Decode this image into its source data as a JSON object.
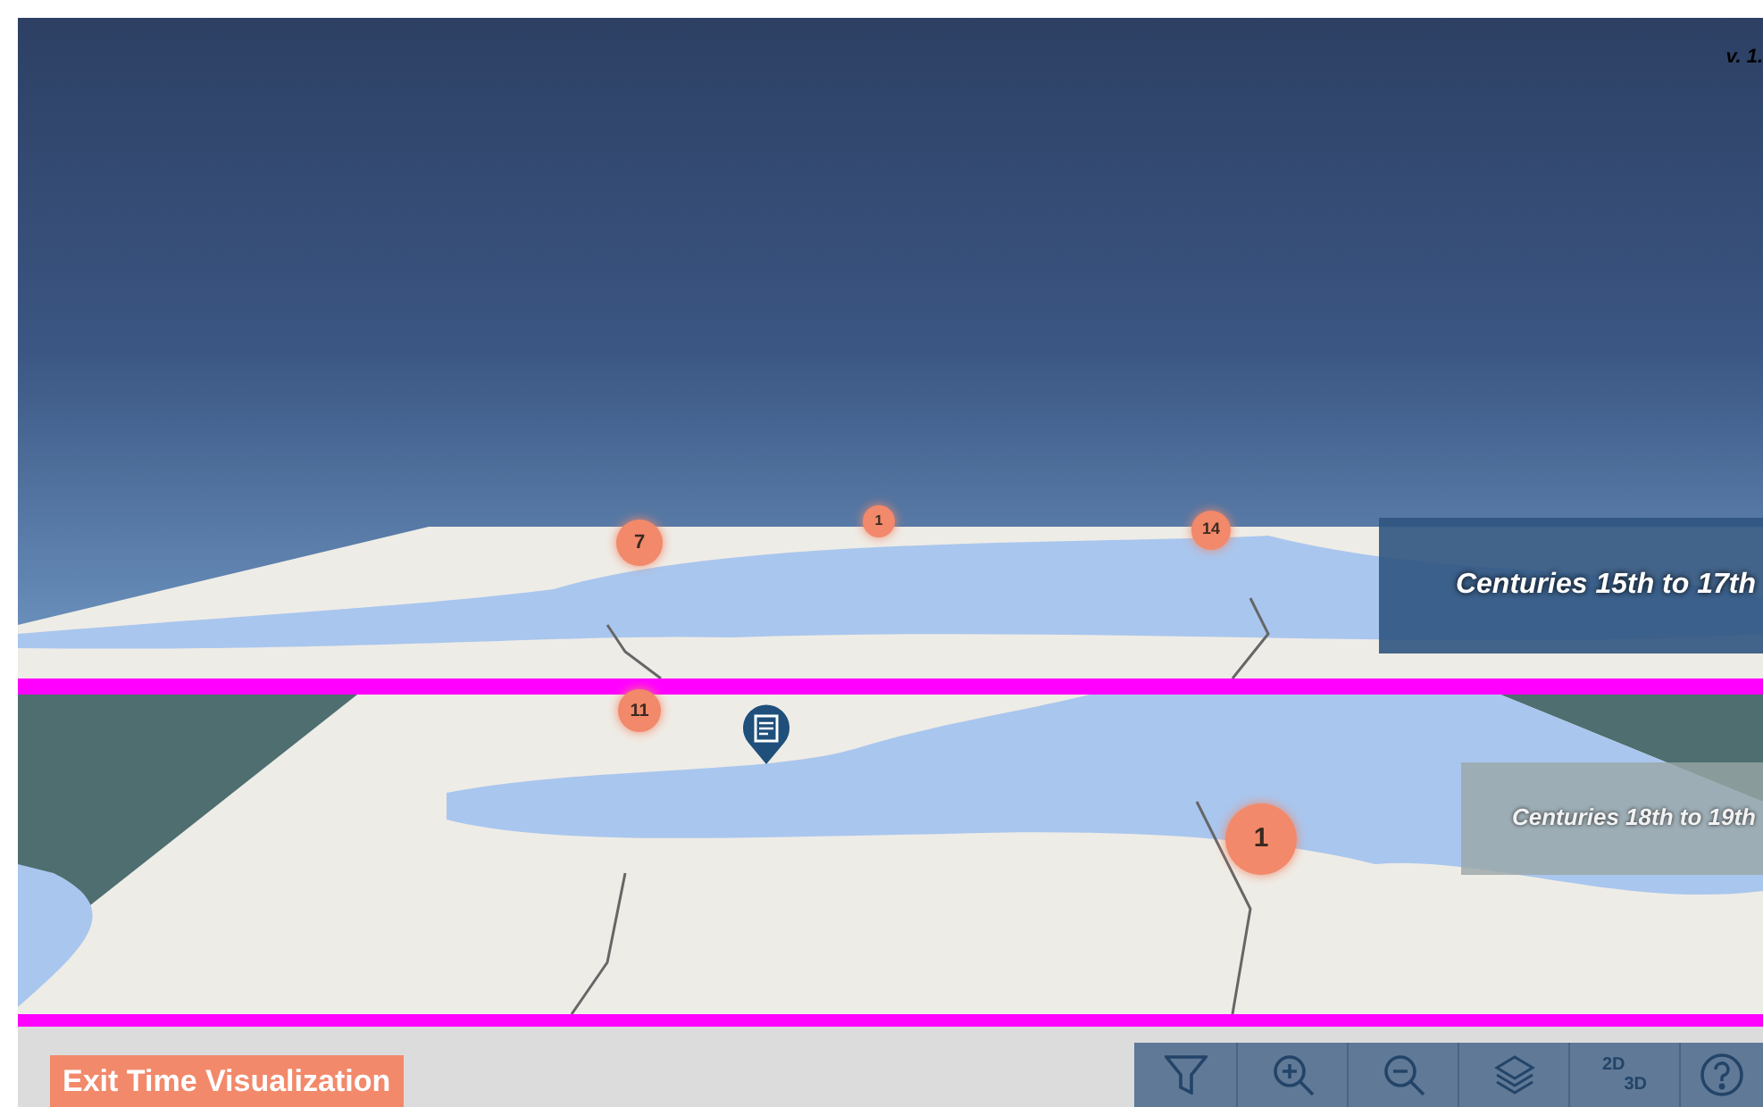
{
  "version": "v. 1.",
  "layers": [
    {
      "label": "Centuries 15th to 17th",
      "selected": true,
      "markers": [
        {
          "kind": "cluster",
          "count": "7"
        },
        {
          "kind": "cluster",
          "count": "1"
        },
        {
          "kind": "cluster",
          "count": "14"
        }
      ]
    },
    {
      "label": "Centuries 18th to 19th",
      "selected": false,
      "markers": [
        {
          "kind": "cluster",
          "count": "11"
        },
        {
          "kind": "pin"
        },
        {
          "kind": "cluster",
          "count": "1"
        }
      ]
    }
  ],
  "exit_button": "Exit Time Visualization",
  "view_toggle": {
    "top": "2D",
    "bottom": "3D"
  }
}
